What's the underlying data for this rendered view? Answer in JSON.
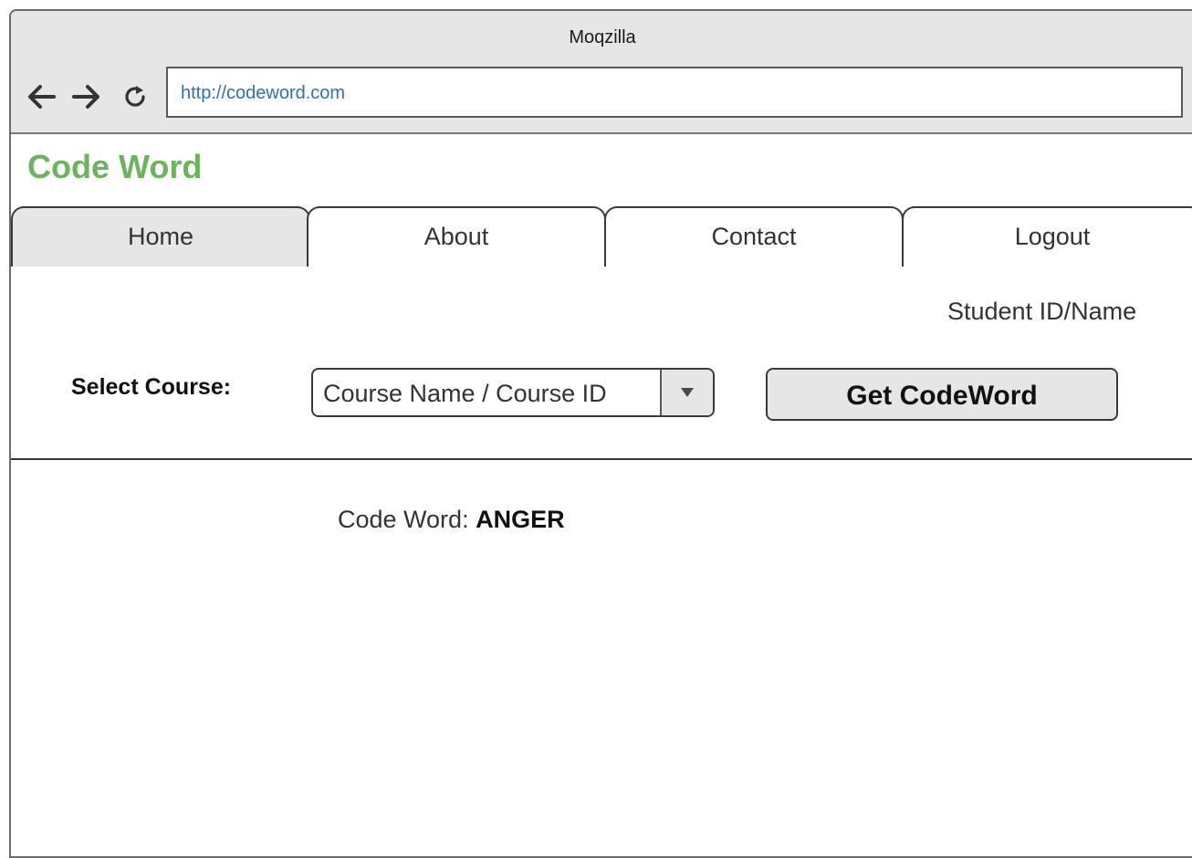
{
  "browser": {
    "window_title": "Moqzilla",
    "address": "http://codeword.com",
    "icons": {
      "back": "arrow-left-icon",
      "forward": "arrow-right-icon",
      "reload": "reload-icon"
    }
  },
  "site": {
    "title": "Code Word",
    "title_color": "#6db35c"
  },
  "tabs": [
    {
      "label": "Home",
      "active": true
    },
    {
      "label": "About",
      "active": false
    },
    {
      "label": "Contact",
      "active": false
    },
    {
      "label": "Logout",
      "active": false
    }
  ],
  "main": {
    "student_label": "Student ID/Name",
    "course_label": "Select Course:",
    "course_select_value": "Course Name / Course ID",
    "course_select_icon": "triangle-down-icon",
    "get_button_label": "Get CodeWord",
    "codeword_prefix": "Code Word:",
    "codeword_value": "ANGER"
  }
}
